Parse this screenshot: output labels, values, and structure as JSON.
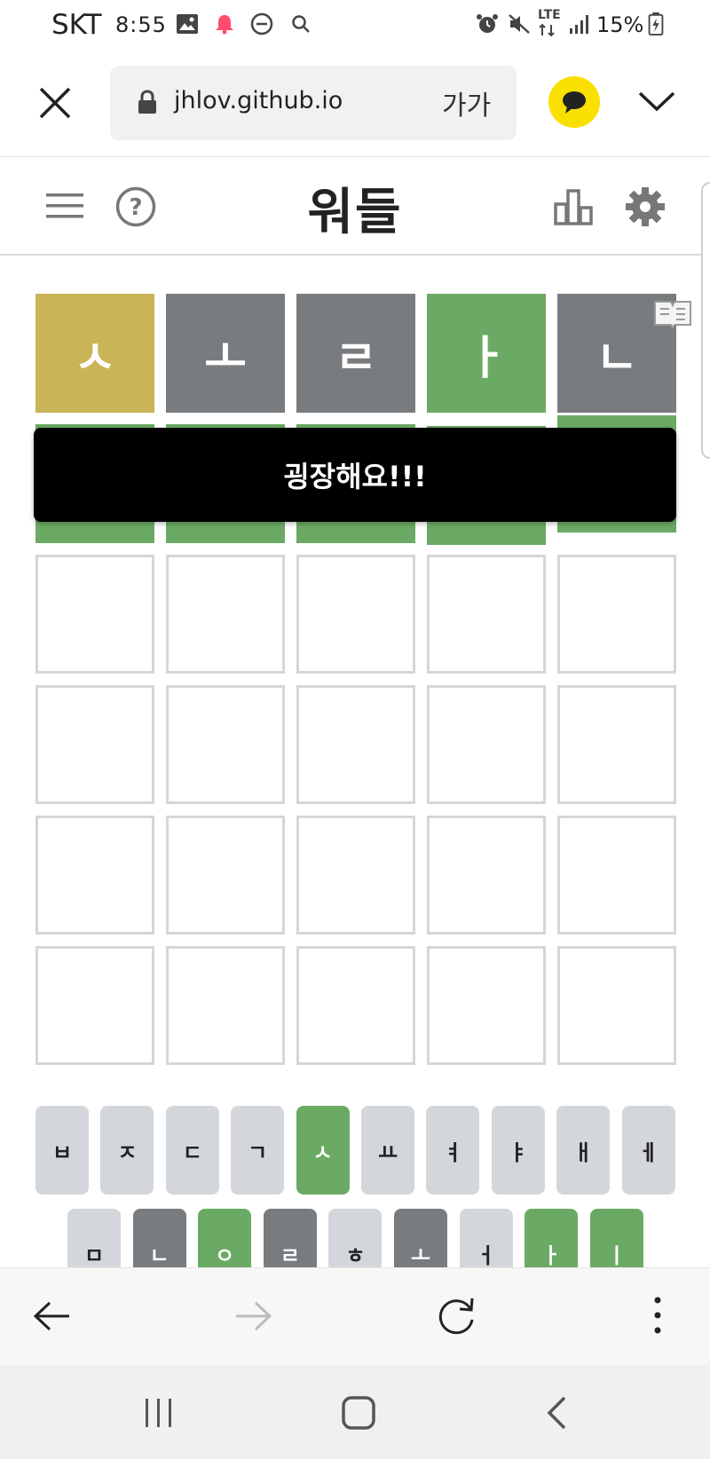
{
  "status_bar": {
    "carrier": "SKT",
    "time": "8:55",
    "battery": "15%",
    "network": "LTE"
  },
  "browser": {
    "url": "jhlov.github.io",
    "text_size_label": "가가"
  },
  "app": {
    "title": "워들"
  },
  "grid": {
    "rows": [
      [
        {
          "letter": "ㅅ",
          "state": "present"
        },
        {
          "letter": "ㅗ",
          "state": "absent"
        },
        {
          "letter": "ㄹ",
          "state": "absent"
        },
        {
          "letter": "ㅏ",
          "state": "correct"
        },
        {
          "letter": "ㄴ",
          "state": "absent"
        }
      ],
      [
        {
          "letter": "",
          "state": "correct"
        },
        {
          "letter": "",
          "state": "correct"
        },
        {
          "letter": "",
          "state": "correct"
        },
        {
          "letter": "",
          "state": "correct"
        },
        {
          "letter": "",
          "state": "correct"
        }
      ],
      [
        {
          "letter": "",
          "state": "empty"
        },
        {
          "letter": "",
          "state": "empty"
        },
        {
          "letter": "",
          "state": "empty"
        },
        {
          "letter": "",
          "state": "empty"
        },
        {
          "letter": "",
          "state": "empty"
        }
      ],
      [
        {
          "letter": "",
          "state": "empty"
        },
        {
          "letter": "",
          "state": "empty"
        },
        {
          "letter": "",
          "state": "empty"
        },
        {
          "letter": "",
          "state": "empty"
        },
        {
          "letter": "",
          "state": "empty"
        }
      ],
      [
        {
          "letter": "",
          "state": "empty"
        },
        {
          "letter": "",
          "state": "empty"
        },
        {
          "letter": "",
          "state": "empty"
        },
        {
          "letter": "",
          "state": "empty"
        },
        {
          "letter": "",
          "state": "empty"
        }
      ],
      [
        {
          "letter": "",
          "state": "empty"
        },
        {
          "letter": "",
          "state": "empty"
        },
        {
          "letter": "",
          "state": "empty"
        },
        {
          "letter": "",
          "state": "empty"
        },
        {
          "letter": "",
          "state": "empty"
        }
      ]
    ]
  },
  "toast": {
    "message": "굉장해요!!!"
  },
  "keyboard": {
    "row1": [
      {
        "key": "ㅂ",
        "state": "unused"
      },
      {
        "key": "ㅈ",
        "state": "unused"
      },
      {
        "key": "ㄷ",
        "state": "unused"
      },
      {
        "key": "ㄱ",
        "state": "unused"
      },
      {
        "key": "ㅅ",
        "state": "correct"
      },
      {
        "key": "ㅛ",
        "state": "unused"
      },
      {
        "key": "ㅕ",
        "state": "unused"
      },
      {
        "key": "ㅑ",
        "state": "unused"
      },
      {
        "key": "ㅐ",
        "state": "unused"
      },
      {
        "key": "ㅔ",
        "state": "unused"
      }
    ],
    "row2": [
      {
        "key": "ㅁ",
        "state": "unused"
      },
      {
        "key": "ㄴ",
        "state": "absent"
      },
      {
        "key": "ㅇ",
        "state": "correct"
      },
      {
        "key": "ㄹ",
        "state": "absent"
      },
      {
        "key": "ㅎ",
        "state": "unused"
      },
      {
        "key": "ㅗ",
        "state": "absent"
      },
      {
        "key": "ㅓ",
        "state": "unused"
      },
      {
        "key": "ㅏ",
        "state": "correct"
      },
      {
        "key": "ㅣ",
        "state": "correct"
      }
    ]
  },
  "colors": {
    "correct": "#6aaa64",
    "present": "#c9b458",
    "absent": "#787c7e",
    "unused_key": "#d3d6da",
    "kakao": "#f9e000"
  },
  "icons": {
    "close": "close-icon",
    "lock": "lock-icon",
    "kakao": "kakaotalk-icon",
    "chevron": "chevron-down-icon",
    "menu": "menu-icon",
    "help": "help-icon",
    "stats": "stats-icon",
    "settings": "gear-icon",
    "back": "arrow-left-icon",
    "forward": "arrow-right-icon",
    "reload": "reload-icon",
    "more": "more-vertical-icon"
  }
}
